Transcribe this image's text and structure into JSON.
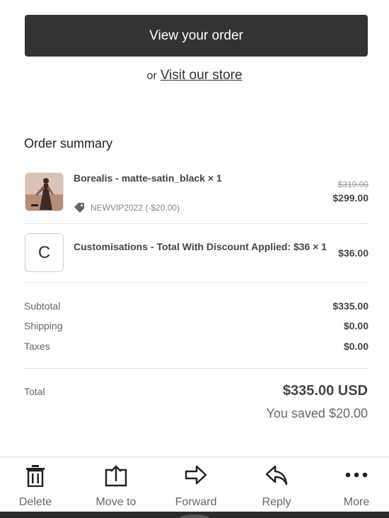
{
  "header": {
    "view_order_label": "View your order",
    "or_text": "or",
    "visit_store_label": "Visit our store"
  },
  "summary": {
    "title": "Order summary",
    "items": [
      {
        "name": "Borealis - matte-satin_black × 1",
        "discount_code": "NEWVIP2022 (-$20.00)",
        "original_price": "$319.00",
        "price": "$299.00",
        "thumb_icon": "product-photo"
      },
      {
        "name": "Customisations - Total With Discount Applied: $36 × 1",
        "thumb_letter": "C",
        "price": "$36.00"
      }
    ],
    "subtotal_label": "Subtotal",
    "subtotal_value": "$335.00",
    "shipping_label": "Shipping",
    "shipping_value": "$0.00",
    "taxes_label": "Taxes",
    "taxes_value": "$0.00",
    "total_label": "Total",
    "total_value": "$335.00 USD",
    "saved_text": "You saved $20.00"
  },
  "toolbar": {
    "items": [
      {
        "label": "Delete",
        "icon": "trash-icon"
      },
      {
        "label": "Move to",
        "icon": "move-to-icon"
      },
      {
        "label": "Forward",
        "icon": "forward-arrow-icon"
      },
      {
        "label": "Reply",
        "icon": "reply-arrow-icon"
      },
      {
        "label": "More",
        "icon": "more-dots-icon"
      }
    ]
  },
  "colors": {
    "button_bg": "#333333",
    "text": "#444444",
    "muted": "#666666"
  }
}
